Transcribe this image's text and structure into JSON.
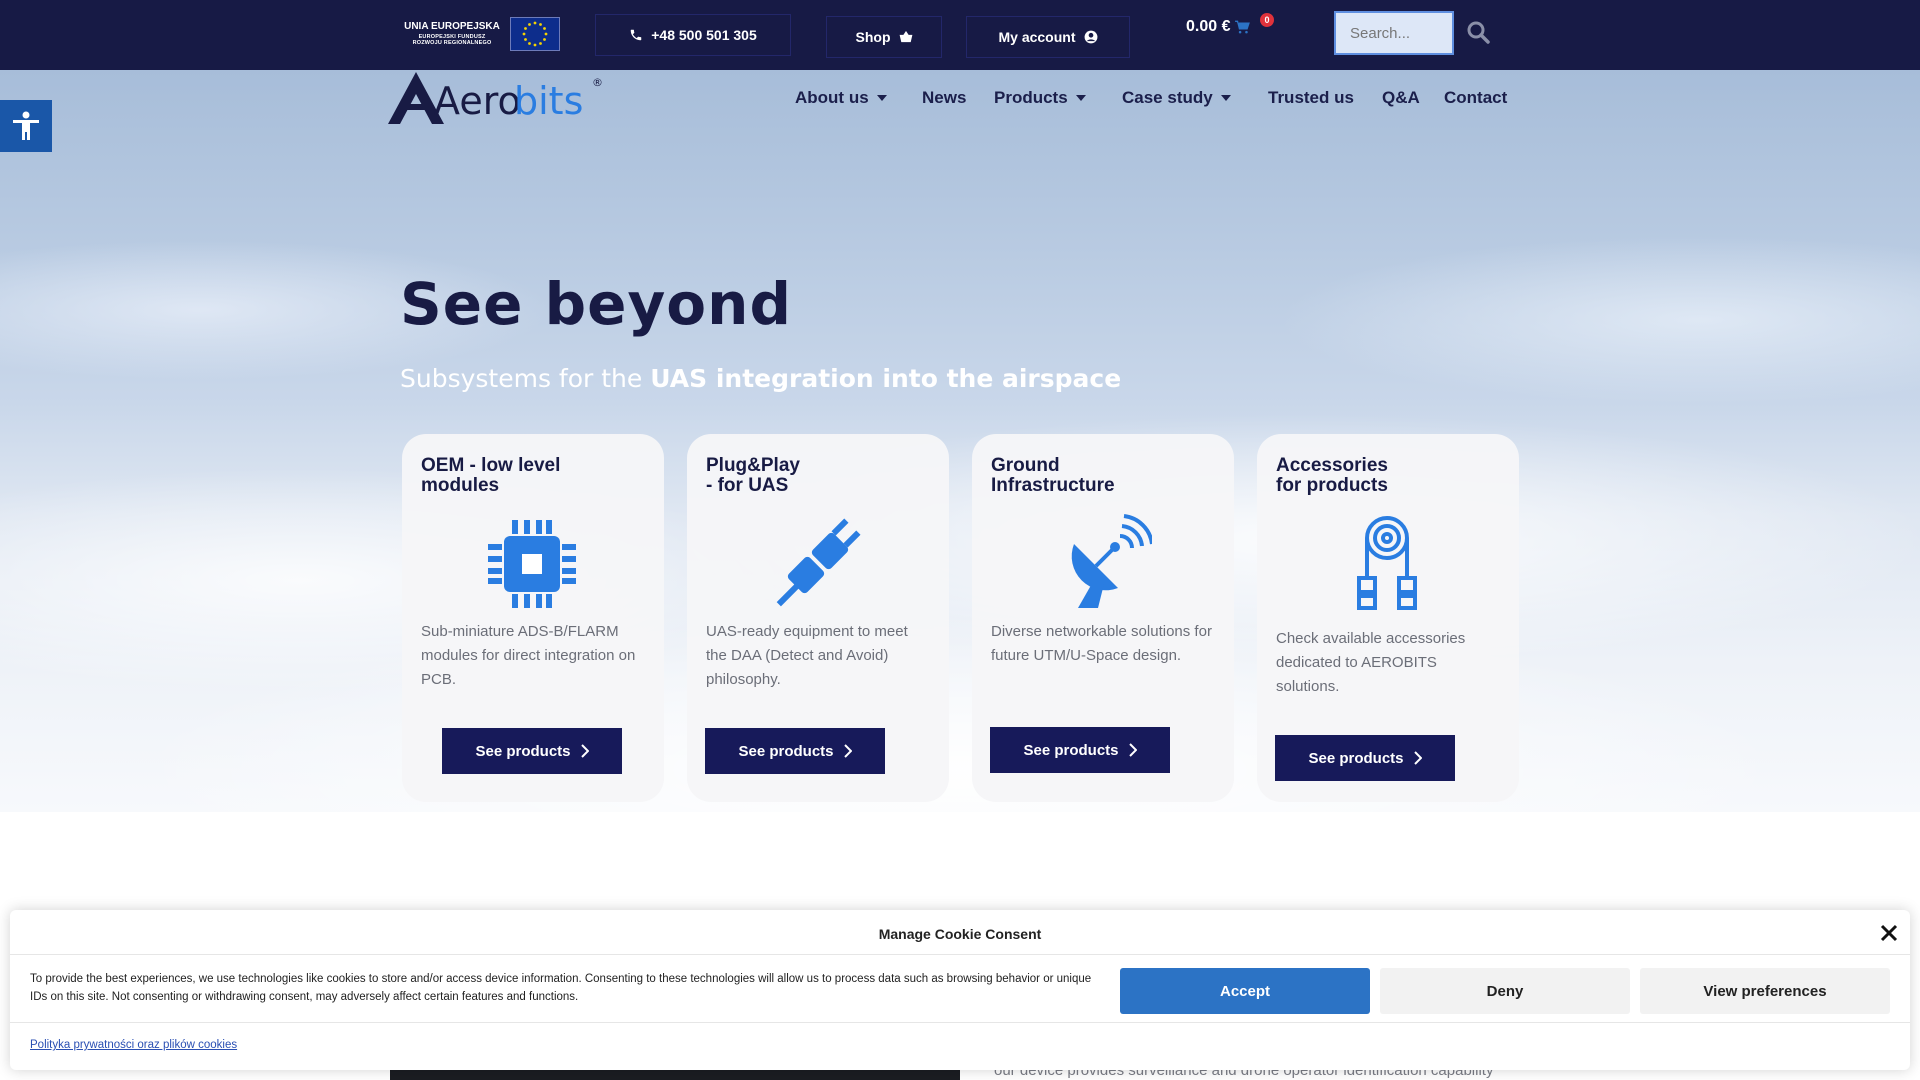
{
  "topbar": {
    "eu_line1": "UNIA EUROPEJSKA",
    "eu_line2": "EUROPEJSKI FUNDUSZ",
    "eu_line3": "ROZWOJU REGIONALNEGO",
    "phone": "+48 500 501 305",
    "shop": "Shop",
    "account": "My account",
    "cart_total": "0.00 €",
    "cart_count": "0",
    "search_placeholder": "Search..."
  },
  "logo": {
    "text_a": "Aero",
    "text_b": "bits",
    "reg": "®"
  },
  "nav": {
    "about": "About us",
    "news": "News",
    "products": "Products",
    "case_study": "Case study",
    "trusted": "Trusted us",
    "qa": "Q&A",
    "contact": "Contact"
  },
  "hero": {
    "title": "See beyond",
    "subtitle_plain": "Subsystems for the ",
    "subtitle_bold": "UAS integration into the airspace"
  },
  "cards": [
    {
      "title": "OEM - low level\nmodules",
      "icon": "chip-icon",
      "desc": "Sub-miniature ADS-B/FLARM modules for direct integration on PCB.",
      "button": "See products"
    },
    {
      "title": "Plug&Play\n- for UAS",
      "icon": "plug-icon",
      "desc": "UAS-ready equipment to meet the DAA (Detect and Avoid) philosophy.",
      "button": "See products"
    },
    {
      "title": "Ground\nInfrastructure",
      "icon": "satellite-dish-icon",
      "desc": "Diverse networkable solutions for future UTM/U-Space design.",
      "button": "See products"
    },
    {
      "title": "Accessories\nfor products",
      "icon": "cable-connector-icon",
      "desc": "Check available accessories dedicated to AEROBITS solutions.",
      "button": "See products"
    }
  ],
  "below": {
    "text": "our device provides surveillance and drone operator identification capability"
  },
  "cookie": {
    "title": "Manage Cookie Consent",
    "text": "To provide the best experiences, we use technologies like cookies to store and/or access device information. Consenting to these technologies will allow us to process data such as browsing behavior or unique IDs on this site. Not consenting or withdrawing consent, may adversely affect certain features and functions.",
    "accept": "Accept",
    "deny": "Deny",
    "preferences": "View preferences",
    "policy_link": "Polityka prywatności oraz plików cookies"
  },
  "colors": {
    "navy": "#171a45",
    "accent_blue": "#2c73c5",
    "icon_blue": "#2a7de1",
    "button_navy": "#171a5a"
  }
}
